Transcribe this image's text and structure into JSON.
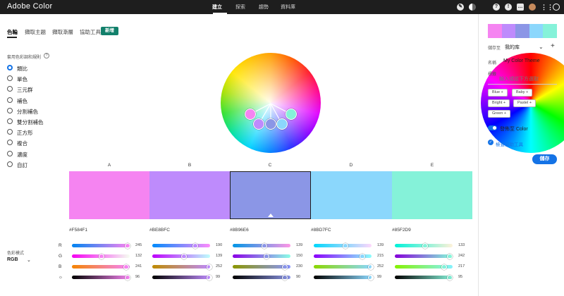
{
  "app": {
    "title": "Adobe Color"
  },
  "nav": [
    {
      "label": "建立",
      "active": true
    },
    {
      "label": "探索",
      "active": false
    },
    {
      "label": "趨勢",
      "active": false
    },
    {
      "label": "資料庫",
      "active": false
    }
  ],
  "toolbar_icons": [
    "pen-tool-icon",
    "contrast-icon",
    "color-wheel-icon",
    "help-icon",
    "info-icon",
    "chat-icon",
    "user-avatar-icon",
    "apps-grid-icon",
    "creative-cloud-icon"
  ],
  "tabs": [
    {
      "label": "色輪",
      "active": true
    },
    {
      "label": "擷取主題",
      "active": false
    },
    {
      "label": "擷取漸層",
      "active": false
    },
    {
      "label": "協助工具",
      "active": false
    }
  ],
  "new_badge": "新增",
  "rules": {
    "title": "套用色彩調和規則",
    "help": "?",
    "items": [
      {
        "label": "類比",
        "selected": true
      },
      {
        "label": "單色",
        "selected": false
      },
      {
        "label": "三元群",
        "selected": false
      },
      {
        "label": "補色",
        "selected": false
      },
      {
        "label": "分割補色",
        "selected": false
      },
      {
        "label": "雙分割補色",
        "selected": false
      },
      {
        "label": "正方形",
        "selected": false
      },
      {
        "label": "複合",
        "selected": false
      },
      {
        "label": "濃度",
        "selected": false
      },
      {
        "label": "自訂",
        "selected": false
      }
    ]
  },
  "color_mode": {
    "label": "色彩模式",
    "value": "RGB",
    "chevron": "⌄"
  },
  "channels": [
    "R",
    "G",
    "B"
  ],
  "brightness_icon": "☼",
  "swatches": [
    {
      "letter": "A",
      "hex": "#F584F1",
      "color": "#F584F1",
      "r": 245,
      "g": 132,
      "b": 241,
      "brightness": 96,
      "selected": false
    },
    {
      "letter": "B",
      "hex": "#BE8BFC",
      "color": "#BE8BFC",
      "r": 190,
      "g": 139,
      "b": 252,
      "brightness": 99,
      "selected": false
    },
    {
      "letter": "C",
      "hex": "#8B96E6",
      "color": "#8B96E6",
      "r": 139,
      "g": 150,
      "b": 230,
      "brightness": 90,
      "selected": true
    },
    {
      "letter": "D",
      "hex": "#8BD7FC",
      "color": "#8BD7FC",
      "r": 139,
      "g": 215,
      "b": 252,
      "brightness": 99,
      "selected": false
    },
    {
      "letter": "E",
      "hex": "#85F2D9",
      "color": "#85F2D9",
      "r": 133,
      "g": 242,
      "b": 217,
      "brightness": 95,
      "selected": false
    }
  ],
  "panel": {
    "save_to_label": "儲存至",
    "library": "我的库",
    "name_label": "名稱",
    "name_value": "My Color Theme",
    "tags_label": "標籤",
    "tags_placeholder": "輸入或從下方選取",
    "tags": [
      "Blue",
      "Baby",
      "Bright",
      "Pastel",
      "Green"
    ],
    "tag_plus": "+",
    "publish_label": "發佈至 Color",
    "publish_on": true,
    "tool_link": "檢查協助工具",
    "save_button": "儲存"
  }
}
